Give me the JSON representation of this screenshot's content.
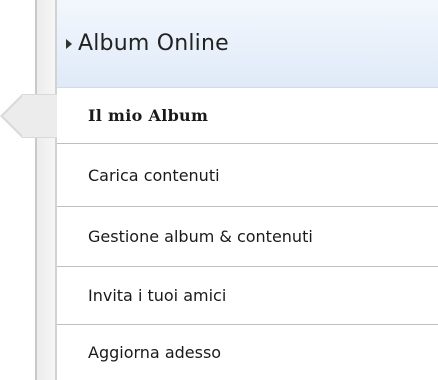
{
  "menu": {
    "header": {
      "title": "Album Online",
      "arrow_icon": "triangle-right-icon"
    },
    "items": [
      {
        "label": "Il mio Album",
        "active": true
      },
      {
        "label": "Carica contenuti",
        "active": false
      },
      {
        "label": "Gestione album & contenuti",
        "active": false
      },
      {
        "label": "Invita i tuoi amici",
        "active": false
      },
      {
        "label": "Aggiorna adesso",
        "active": false
      }
    ]
  },
  "colors": {
    "header_gradient_top": "#f3f7fd",
    "header_gradient_bottom": "#dfeaf8",
    "divider": "#bfbfbf",
    "active_indicator": "#ececec"
  }
}
